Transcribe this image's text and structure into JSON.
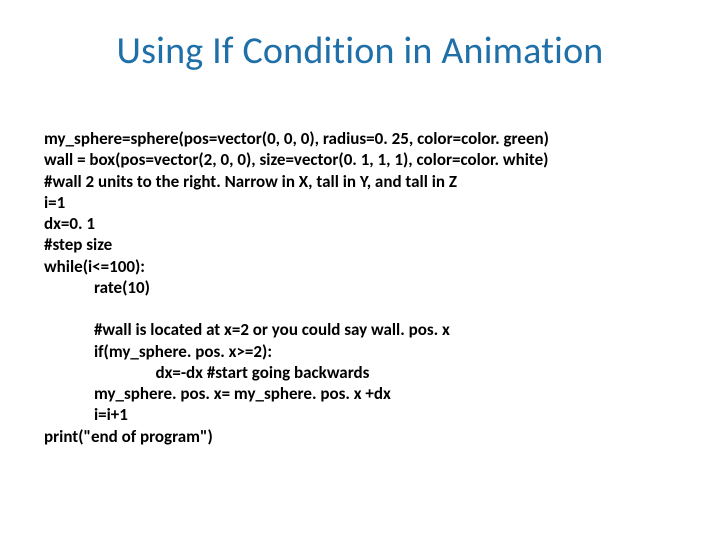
{
  "title": "Using If Condition in Animation",
  "code": {
    "line1": "my_sphere=sphere(pos=vector(0, 0, 0), radius=0. 25, color=color. green)",
    "line2": "wall = box(pos=vector(2, 0, 0), size=vector(0. 1, 1, 1), color=color. white)",
    "line3": "#wall 2 units to the right. Narrow in X, tall in Y, and tall in Z",
    "line4": "i=1",
    "line5": "dx=0. 1",
    "line6": "#step size",
    "line7": "while(i<=100):",
    "line8": "             rate(10)",
    "line9": "",
    "line10": "             #wall is located at x=2 or you could say wall. pos. x",
    "line11": "             if(my_sphere. pos. x>=2):",
    "line12": "                             dx=-dx #start going backwards",
    "line13": "             my_sphere. pos. x= my_sphere. pos. x +dx",
    "line14": "             i=i+1",
    "line15": "print(\"end of program\")"
  }
}
